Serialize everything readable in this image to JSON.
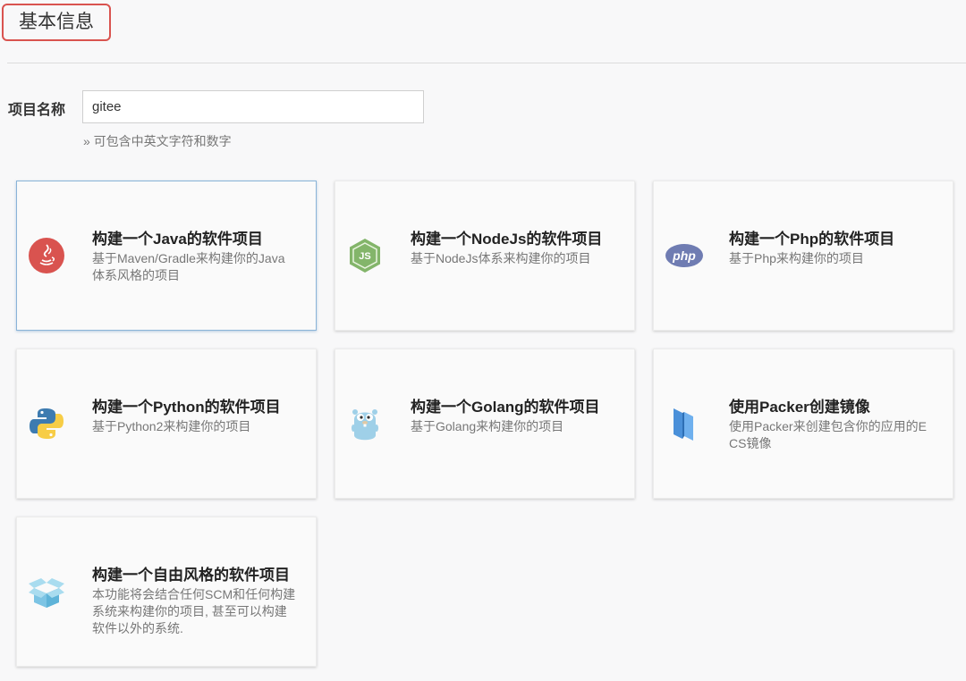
{
  "section": {
    "title": "基本信息"
  },
  "project_name": {
    "label": "项目名称",
    "value": "gitee",
    "hint": "» 可包含中英文字符和数字"
  },
  "cards": [
    {
      "title": "构建一个Java的软件项目",
      "desc": "基于Maven/Gradle来构建你的Java体系风格的项目",
      "icon": "java-icon"
    },
    {
      "title": "构建一个NodeJs的软件项目",
      "desc": "基于NodeJs体系来构建你的项目",
      "icon": "nodejs-icon"
    },
    {
      "title": "构建一个Php的软件项目",
      "desc": "基于Php来构建你的项目",
      "icon": "php-icon"
    },
    {
      "title": "构建一个Python的软件项目",
      "desc": "基于Python2来构建你的项目",
      "icon": "python-icon"
    },
    {
      "title": "构建一个Golang的软件项目",
      "desc": "基于Golang来构建你的项目",
      "icon": "golang-gopher-icon"
    },
    {
      "title": "使用Packer创建镜像",
      "desc": "使用Packer来创建包含你的应用的ECS镜像",
      "icon": "packer-icon"
    },
    {
      "title": "构建一个自由风格的软件项目",
      "desc": "本功能将会结合任何SCM和任何构建系统来构建你的项目, 甚至可以构建软件以外的系统.",
      "icon": "open-box-icon"
    }
  ],
  "php_icon_text": "php",
  "nodejs_icon_text": "JS",
  "colors": {
    "accent_border": "#d9534f",
    "selected_border": "#8ab4d8"
  }
}
